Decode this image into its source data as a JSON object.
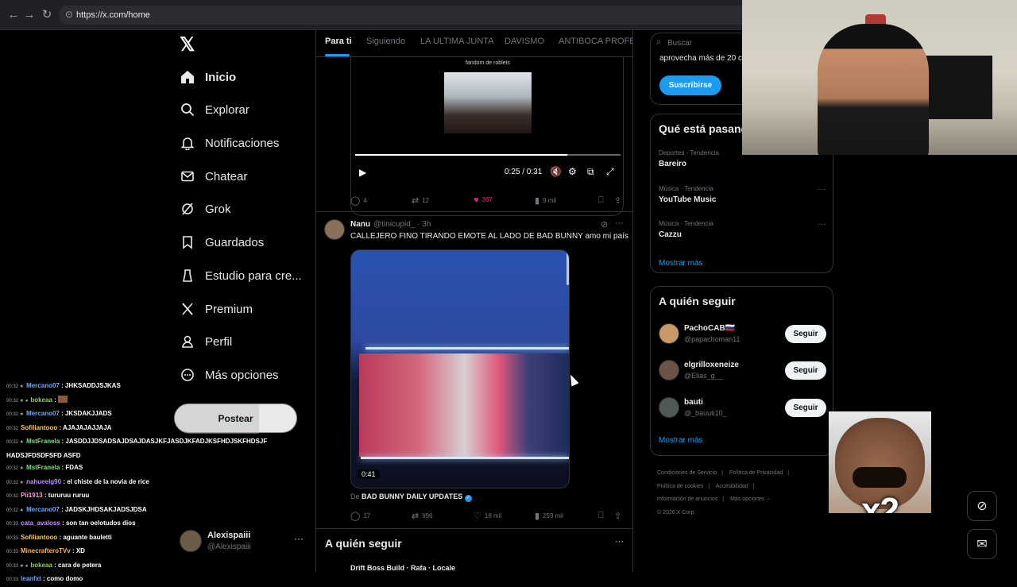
{
  "browser": {
    "url": "https://x.com/home"
  },
  "sidebar": {
    "items": [
      {
        "label": "Inicio",
        "icon": "home-icon"
      },
      {
        "label": "Explorar",
        "icon": "search-icon"
      },
      {
        "label": "Notificaciones",
        "icon": "bell-icon"
      },
      {
        "label": "Chatear",
        "icon": "mail-icon"
      },
      {
        "label": "Grok",
        "icon": "grok-icon"
      },
      {
        "label": "Guardados",
        "icon": "bookmark-icon"
      },
      {
        "label": "Estudio para cre...",
        "icon": "studio-icon"
      },
      {
        "label": "Premium",
        "icon": "x-icon"
      },
      {
        "label": "Perfil",
        "icon": "person-icon"
      },
      {
        "label": "Más opciones",
        "icon": "more-icon"
      }
    ],
    "post_label": "Postear",
    "profile": {
      "name": "Alexispaiii",
      "handle": "@Alexispaiii"
    }
  },
  "chat": [
    {
      "user": "Mercano07",
      "user_color": "#6fa8ff",
      "msg": ": JHKSADDJSJKAS"
    },
    {
      "user": "bokeaa",
      "user_color": "#8fd14f",
      "msg": ":"
    },
    {
      "user": "Mercano07",
      "user_color": "#6fa8ff",
      "msg": ": JKSDAKJJADS"
    },
    {
      "user": "Sofiliantooo",
      "user_color": "#ffc94d",
      "msg": ": AJAJAJAJJAJA"
    },
    {
      "user": "MstFranela",
      "user_color": "#7be07b",
      "msg": ": JASDDJJDSADSAJDSAJDASJKFJASDJKFADJKSFHDJSKFHDSJFHADSJFDSDFSFD ASFD"
    },
    {
      "user": "MstFranela",
      "user_color": "#7be07b",
      "msg": ": FDAS"
    },
    {
      "user": "nahueelg90",
      "user_color": "#b88cff",
      "msg": ": el chiste de la novia de rice"
    },
    {
      "user": "Pii1913",
      "user_color": "#ff9de0",
      "msg": ": tururuu ruruu"
    },
    {
      "user": "Mercano07",
      "user_color": "#6fa8ff",
      "msg": ": JADSKJHDSAKJADSJDSA"
    },
    {
      "user": "cata_avaloss",
      "user_color": "#c78bff",
      "msg": ": son tan oelotudos dios"
    },
    {
      "user": "Sofiliantooo",
      "user_color": "#ffc94d",
      "msg": ": aguante bauletti"
    },
    {
      "user": "MinecrafteroTVv",
      "user_color": "#ffb84d",
      "msg": ": XD"
    },
    {
      "user": "bokeaa",
      "user_color": "#8fd14f",
      "msg": ": cara de petera"
    },
    {
      "user": "leanfxt",
      "user_color": "#6fa8ff",
      "msg": ": como domo"
    }
  ],
  "tabs": [
    "Para ti",
    "Siguiendo",
    "LA ULTIMA JUNTA",
    "DAVISMO",
    "ANTIBOCA PROFESI"
  ],
  "tweet1": {
    "caption": "fandom de roblets",
    "time": "0:25 / 0:31",
    "replies": "4",
    "retweets": "12",
    "likes": "367",
    "views": "9 mil"
  },
  "tweet2": {
    "name": "Nanu",
    "handle": "@tinicupid_ · 3h",
    "text": "CALLEJERO FINO TIRANDO EMOTE AL LADO DE BAD BUNNY amo mi país",
    "duration": "0:41",
    "from_prefix": "De",
    "from_account": "BAD BUNNY DAILY UPDATES",
    "replies": "17",
    "retweets": "996",
    "likes": "18 mil",
    "views": "259 mil"
  },
  "center_follow": {
    "title": "A quién seguir",
    "peek": "Drift Boss Build · Rafa · Locale"
  },
  "right": {
    "search_placeholder": "Buscar",
    "subscribe_text": "aprovecha más de 20 c",
    "subscribe_label": "Suscribirse",
    "trends_title": "Qué está pasando",
    "trends": [
      {
        "meta": "Deportes · Tendencia",
        "topic": "Bareiro"
      },
      {
        "meta": "Música · Tendencia",
        "topic": "YouTube Music"
      },
      {
        "meta": "Música · Tendencia",
        "topic": "Cazzu"
      }
    ],
    "trends_more": "Mostrar más",
    "follow_title": "A quién seguir",
    "follow": [
      {
        "name": "PachoCAB🇷🇺",
        "handle": "@papachoman11",
        "button": "Seguir"
      },
      {
        "name": "elgrilloxeneize",
        "handle": "@Elias_g__",
        "button": "Seguir"
      },
      {
        "name": "bauti",
        "handle": "@_bauuti10_",
        "button": "Seguir"
      }
    ],
    "follow_more": "Mostrar más",
    "footer": [
      "Condiciones de Servicio",
      "|",
      "Política de Privacidad",
      "|",
      "Política de cookies",
      "|",
      "Accesibilidad",
      "|",
      "Información de anuncios",
      "|",
      "Más opciones ···",
      "© 2026 X Corp."
    ]
  },
  "overlay": {
    "meme_text": "x2"
  },
  "colors": {
    "accent": "#1d9bf0",
    "like": "#f91880",
    "background": "#000000"
  }
}
